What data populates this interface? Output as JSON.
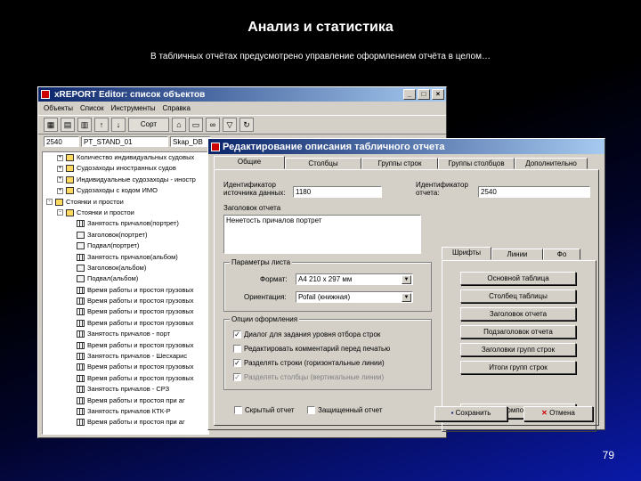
{
  "slide": {
    "title": "Анализ и статистика",
    "subtitle": "В табличных отчётах предусмотрено управление оформлением отчёта в целом…",
    "page_number": "79"
  },
  "main_window": {
    "title": "xREPORT Editor: список объектов",
    "menu": [
      "Объекты",
      "Список",
      "Инструменты",
      "Справка"
    ],
    "toolbar_sort_label": "Сорт",
    "fields": [
      "2540",
      "PT_STAND_01",
      "Skap_DB"
    ],
    "tree": [
      {
        "label": "Количество индивидуальных судовых",
        "level": 1,
        "kind": "folder",
        "exp": "+"
      },
      {
        "label": "Судозаходы иностранных судов",
        "level": 1,
        "kind": "folder",
        "exp": "+"
      },
      {
        "label": "Индивидуальные судозаходы - иностр",
        "level": 1,
        "kind": "folder",
        "exp": "+"
      },
      {
        "label": "Судозаходы с кодом ИМО",
        "level": 1,
        "kind": "folder",
        "exp": "+"
      },
      {
        "label": "Стоянки и простои",
        "level": 0,
        "kind": "folder",
        "exp": "-"
      },
      {
        "label": "Стоянки и простои",
        "level": 1,
        "kind": "folder",
        "exp": "-"
      },
      {
        "label": "Занятость причалов(портрет)",
        "level": 2,
        "kind": "grid",
        "exp": ""
      },
      {
        "label": "Заголовок(портрет)",
        "level": 2,
        "kind": "doc",
        "exp": ""
      },
      {
        "label": "Подвал(портрет)",
        "level": 2,
        "kind": "doc",
        "exp": ""
      },
      {
        "label": "Занятость причалов(альбом)",
        "level": 2,
        "kind": "grid",
        "exp": ""
      },
      {
        "label": "Заголовок(альбом)",
        "level": 2,
        "kind": "doc",
        "exp": ""
      },
      {
        "label": "Подвал(альбом)",
        "level": 2,
        "kind": "doc",
        "exp": ""
      },
      {
        "label": "Время работы и простоя грузовых",
        "level": 2,
        "kind": "grid",
        "exp": ""
      },
      {
        "label": "Время работы и простоя грузовых",
        "level": 2,
        "kind": "grid",
        "exp": ""
      },
      {
        "label": "Время работы и простоя грузовых",
        "level": 2,
        "kind": "grid",
        "exp": ""
      },
      {
        "label": "Время работы и простоя грузовых",
        "level": 2,
        "kind": "grid",
        "exp": ""
      },
      {
        "label": "Занятость причалов - порт",
        "level": 2,
        "kind": "grid",
        "exp": ""
      },
      {
        "label": "Время работы и простоя грузовых",
        "level": 2,
        "kind": "grid",
        "exp": ""
      },
      {
        "label": "Занятость причалов - Шесхарис",
        "level": 2,
        "kind": "grid",
        "exp": ""
      },
      {
        "label": "Время работы и простоя грузовых",
        "level": 2,
        "kind": "grid",
        "exp": ""
      },
      {
        "label": "Время работы и простоя грузовых",
        "level": 2,
        "kind": "grid",
        "exp": ""
      },
      {
        "label": "Занятость причалов - СРЗ",
        "level": 2,
        "kind": "grid",
        "exp": ""
      },
      {
        "label": "Время работы и простоя при аг",
        "level": 2,
        "kind": "grid",
        "exp": ""
      },
      {
        "label": "Занятость причалов КТК-Р",
        "level": 2,
        "kind": "grid",
        "exp": ""
      },
      {
        "label": "Время работы и простоя при аг",
        "level": 2,
        "kind": "grid",
        "exp": ""
      }
    ]
  },
  "dialog": {
    "title": "Редактирование описания табличного отчета",
    "tabs": [
      "Общие",
      "Столбцы",
      "Группы строк",
      "Группы столбцов",
      "Дополнительно"
    ],
    "id_label": "Идентификатор источника данных:",
    "id_value": "1180",
    "report_id_label": "Идентификатор отчета:",
    "report_id_value": "2540",
    "title_label": "Заголовок отчета",
    "title_value": "Ненетость причалов портрет",
    "page_params_group": "Параметры листа",
    "format_label": "Формат:",
    "format_value": "А4 210 x 297 мм",
    "orientation_label": "Ориентация:",
    "orientation_value": "Роfail (книжная)",
    "design_group": "Опции оформления",
    "options": [
      {
        "label": "Диалог для задания уровня отбора строк",
        "checked": true,
        "disabled": false
      },
      {
        "label": "Редактировать комментарий перед печатью",
        "checked": false,
        "disabled": false
      },
      {
        "label": "Разделять строки (горизонтальные линии)",
        "checked": true,
        "disabled": false
      },
      {
        "label": "Разделять столбцы (вертикальные линии)",
        "checked": true,
        "disabled": true
      }
    ],
    "hidden_label": "Скрытый отчет",
    "protected_label": "Защищенный отчет",
    "subtabs": [
      "Шрифты",
      "Линии",
      "Фо"
    ],
    "font_buttons": [
      "Основной таблица",
      "Столбец таблицы",
      "Заголовок отчета",
      "Подзаголовок отчета",
      "Заголовки групп строк",
      "Итоги групп строк"
    ],
    "compose_label": "Композиция",
    "save_label": "Сохранить",
    "cancel_label": "Отмена"
  }
}
